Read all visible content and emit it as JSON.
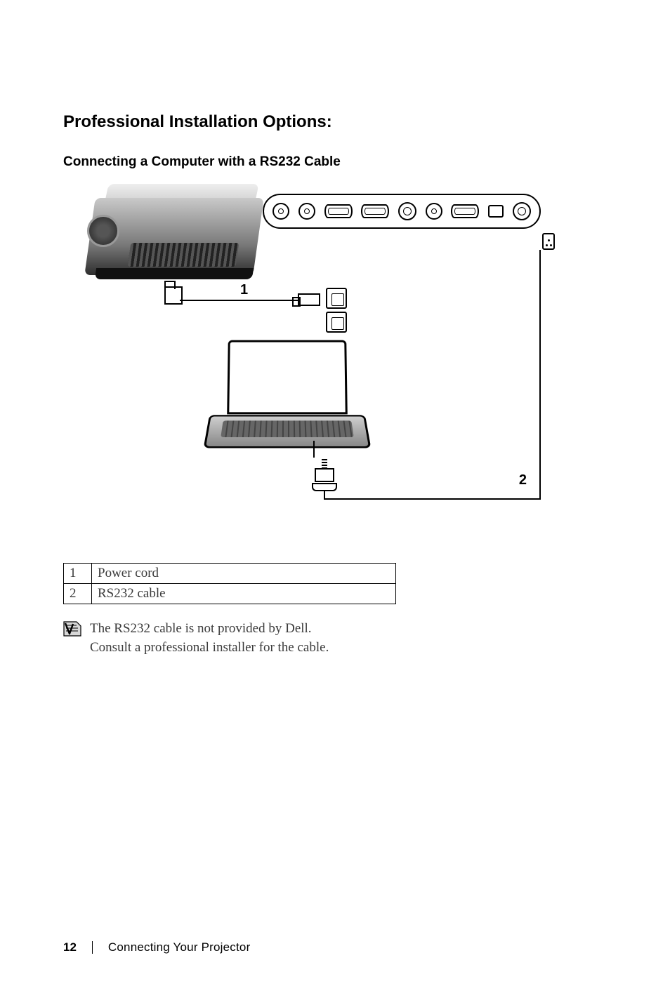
{
  "headings": {
    "h1": "Professional Installation Options:",
    "h2": "Connecting a Computer with a RS232 Cable"
  },
  "diagram": {
    "labels": {
      "cable1": "1",
      "cable2": "2"
    }
  },
  "parts": [
    {
      "num": "1",
      "name": "Power cord"
    },
    {
      "num": "2",
      "name": "RS232 cable"
    }
  ],
  "note": {
    "line1": "The RS232 cable is not provided by Dell.",
    "line2": "Consult a professional installer for the cable."
  },
  "footer": {
    "page": "12",
    "section": "Connecting Your Projector"
  }
}
